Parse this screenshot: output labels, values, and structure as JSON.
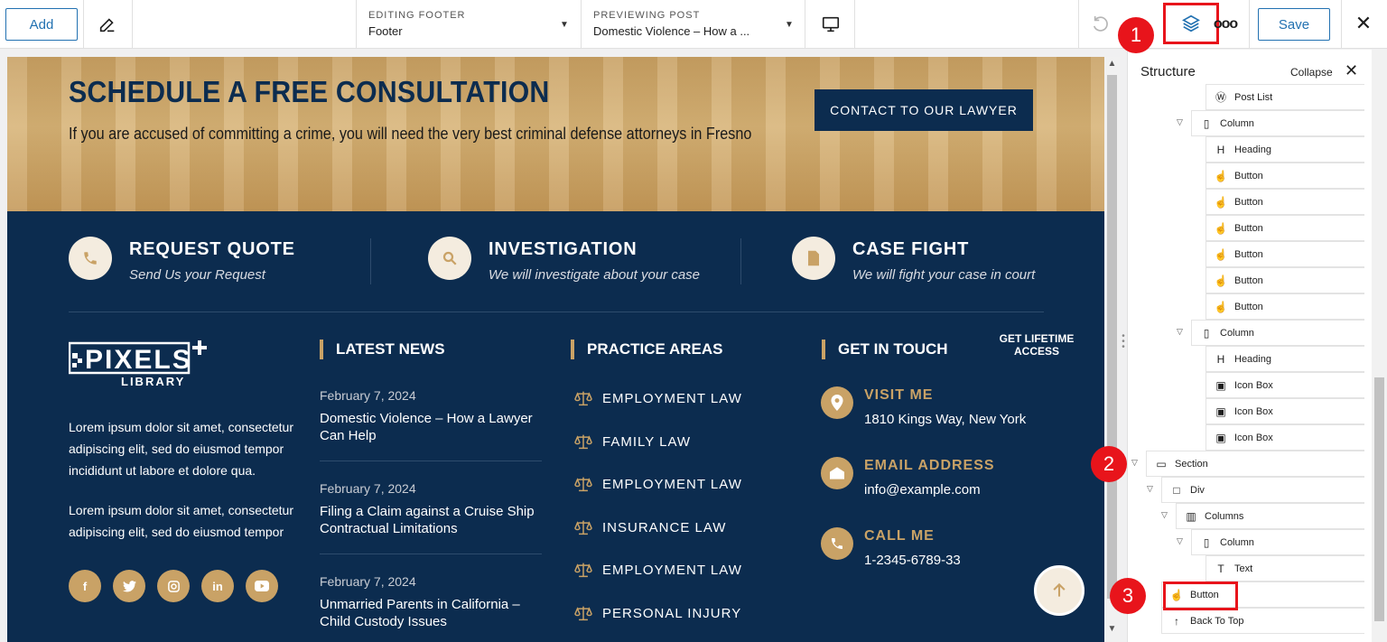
{
  "toolbar": {
    "add_label": "Add",
    "editing_caption": "EDITING FOOTER",
    "editing_value": "Footer",
    "previewing_caption": "PREVIEWING POST",
    "previewing_value": "Domestic Violence – How a ...",
    "save_label": "Save",
    "more_label": "ooo"
  },
  "markers": [
    "1",
    "2",
    "3"
  ],
  "hero": {
    "title": "SCHEDULE A FREE CONSULTATION",
    "subtitle": "If you are accused of committing a crime, you will need the very best criminal defense attorneys in Fresno",
    "button": "CONTACT TO OUR LAWYER"
  },
  "features": [
    {
      "title": "REQUEST QUOTE",
      "subtitle": "Send Us your Request",
      "icon": "phone-icon"
    },
    {
      "title": "INVESTIGATION",
      "subtitle": "We will investigate about your case",
      "icon": "search-icon"
    },
    {
      "title": "CASE FIGHT",
      "subtitle": "We will fight your case in court",
      "icon": "document-icon"
    }
  ],
  "about": {
    "logo_text": "PIXELS LIBRARY",
    "p1": "Lorem ipsum dolor sit amet, consectetur adipiscing elit, sed do eiusmod tempor incididunt ut labore et dolore qua.",
    "p2": "Lorem ipsum dolor sit amet, consectetur adipiscing elit, sed do eiusmod tempor",
    "social": [
      "f",
      "twitter",
      "instagram",
      "in",
      "youtube"
    ]
  },
  "news": {
    "heading": "LATEST NEWS",
    "items": [
      {
        "date": "February 7, 2024",
        "title": "Domestic Violence – How a Lawyer Can Help"
      },
      {
        "date": "February 7, 2024",
        "title": "Filing a Claim against a Cruise Ship Contractual Limitations"
      },
      {
        "date": "February 7, 2024",
        "title": "Unmarried Parents in California – Child Custody Issues"
      }
    ]
  },
  "practice": {
    "heading": "PRACTICE AREAS",
    "items": [
      "EMPLOYMENT LAW",
      "FAMILY LAW",
      "EMPLOYMENT LAW",
      "INSURANCE LAW",
      "EMPLOYMENT LAW",
      "PERSONAL INJURY"
    ]
  },
  "touch": {
    "heading": "GET IN TOUCH",
    "lifetime": "GET LIFETIME ACCESS",
    "items": [
      {
        "title": "VISIT ME",
        "value": "1810 Kings Way, New York"
      },
      {
        "title": "EMAIL ADDRESS",
        "value": "info@example.com"
      },
      {
        "title": "CALL ME",
        "value": "1-2345-6789-33"
      }
    ]
  },
  "structure": {
    "title": "Structure",
    "collapse": "Collapse",
    "rows": [
      {
        "label": "Post List",
        "icon": "wordpress-icon"
      },
      {
        "label": "Column",
        "icon": "column-icon"
      },
      {
        "label": "Heading",
        "icon": "heading-icon"
      },
      {
        "label": "Button",
        "icon": "pointer-icon"
      },
      {
        "label": "Button",
        "icon": "pointer-icon"
      },
      {
        "label": "Button",
        "icon": "pointer-icon"
      },
      {
        "label": "Button",
        "icon": "pointer-icon"
      },
      {
        "label": "Button",
        "icon": "pointer-icon"
      },
      {
        "label": "Button",
        "icon": "pointer-icon"
      },
      {
        "label": "Column",
        "icon": "column-icon"
      },
      {
        "label": "Heading",
        "icon": "heading-icon"
      },
      {
        "label": "Icon Box",
        "icon": "image-icon"
      },
      {
        "label": "Icon Box",
        "icon": "image-icon"
      },
      {
        "label": "Icon Box",
        "icon": "image-icon"
      },
      {
        "label": "Section",
        "icon": "section-icon"
      },
      {
        "label": "Div",
        "icon": "div-icon"
      },
      {
        "label": "Columns",
        "icon": "columns-icon"
      },
      {
        "label": "Column",
        "icon": "column-icon"
      },
      {
        "label": "Text",
        "icon": "text-icon"
      },
      {
        "label": "Button",
        "icon": "pointer-icon"
      },
      {
        "label": "Back To Top",
        "icon": "arrow-up-icon"
      }
    ]
  },
  "colors": {
    "navy": "#0c2c4f",
    "gold": "#c9a266",
    "accent_blue": "#2271b1",
    "highlight_red": "#e8141b"
  }
}
